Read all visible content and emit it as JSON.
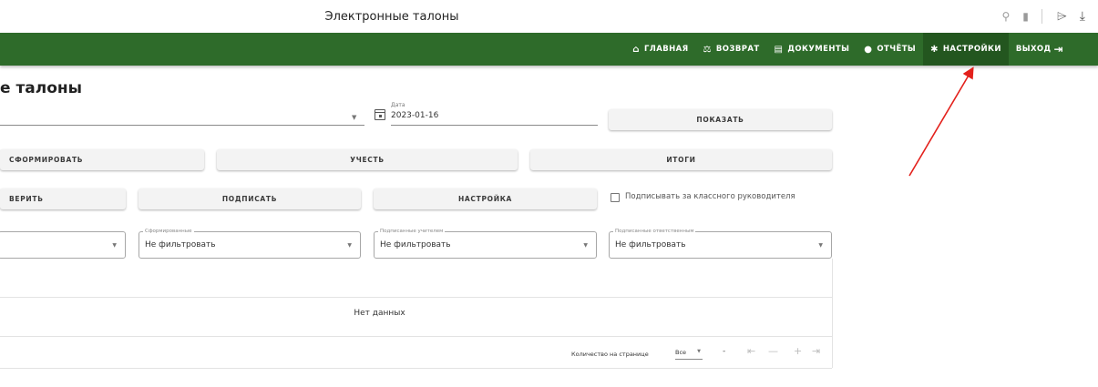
{
  "window": {
    "title": "Электронные талоны"
  },
  "nav": {
    "items": [
      {
        "label": "ГЛАВНАЯ",
        "icon": "⌂"
      },
      {
        "label": "ВОЗВРАТ",
        "icon": "⚖"
      },
      {
        "label": "ДОКУМЕНТЫ",
        "icon": "▤"
      },
      {
        "label": "ОТЧЁТЫ",
        "icon": "●"
      },
      {
        "label": "НАСТРОЙКИ",
        "icon": "✱"
      },
      {
        "label": "ВЫХОД",
        "icon": "⇥"
      }
    ],
    "active": "НАСТРОЙКИ",
    "bar_color": "#2e6b2a"
  },
  "page": {
    "title": "е талоны"
  },
  "date": {
    "label": "Дата",
    "value": "2023-01-16"
  },
  "buttons": {
    "show": "ПОКАЗАТЬ",
    "form": "СФОРМИРОВАТЬ",
    "account": "УЧЕСТЬ",
    "totals": "ИТОГИ",
    "verify": "ВЕРИТЬ",
    "sign": "ПОДПИСАТЬ",
    "setup": "НАСТРОЙКА"
  },
  "checkbox": {
    "label": "Подписывать за классного руководителя",
    "checked": false
  },
  "filters": [
    {
      "label": "",
      "value": ""
    },
    {
      "label": "Сформированные",
      "value": "Не фильтровать"
    },
    {
      "label": "Подписанные учителем",
      "value": "Не фильтровать"
    },
    {
      "label": "Подписанные ответственным",
      "value": "Не фильтровать"
    }
  ],
  "table": {
    "empty_text": "Нет данных"
  },
  "pagination": {
    "rows_label": "Количество на странице",
    "rows_value": "Все",
    "range": "-"
  },
  "annotation": {
    "arrow_color": "#e3201b"
  }
}
